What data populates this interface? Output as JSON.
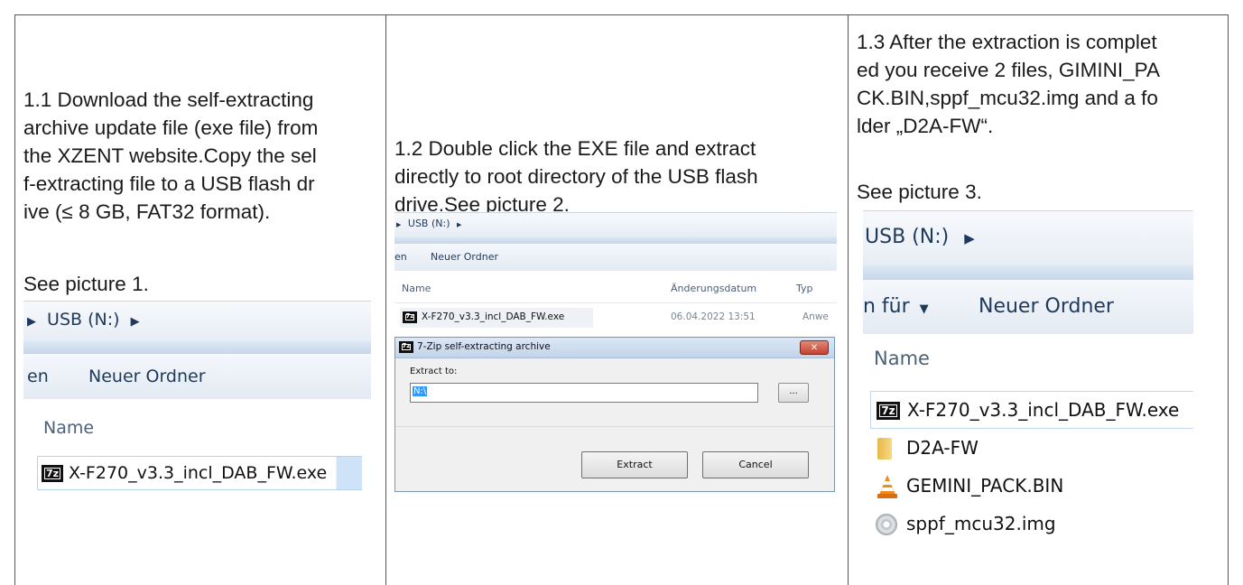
{
  "columns": [
    {
      "step_text": "1.1 Download the self-extracting\narchive update file (exe file) from\nthe XZENT website.Copy the sel\nf-extracting file to a USB flash dr\nive (≤ 8 GB, FAT32 format).",
      "picture_ref": "See picture 1.",
      "screenshot": {
        "breadcrumb": "USB (N:)",
        "toolbar_cut": "en",
        "new_folder": "Neuer Ordner",
        "column_name": "Name",
        "file_name": "X-F270_v3.3_incl_DAB_FW.exe"
      }
    },
    {
      "step_text": "1.2 Double click the EXE file and extract\ndirectly to root directory of the USB flash\ndrive.See picture 2.",
      "screenshot": {
        "breadcrumb": "USB (N:)",
        "toolbar_cut": "en",
        "new_folder": "Neuer Ordner",
        "column_name": "Name",
        "column_date": "Änderungsdatum",
        "column_type": "Typ",
        "file_name": "X-F270_v3.3_incl_DAB_FW.exe",
        "file_date": "06.04.2022 13:51",
        "file_type": "Anwe",
        "dialog": {
          "title": "7-Zip self-extracting archive",
          "close_glyph": "✕",
          "extract_to_label": "Extract to:",
          "path_value": "N:\\",
          "browse_label": "...",
          "extract_button": "Extract",
          "cancel_button": "Cancel"
        }
      }
    },
    {
      "step_text": "1.3 After the extraction is complet\ned you receive 2 files, GIMINI_PA\nCK.BIN,sppf_mcu32.img and a fo\nlder „D2A-FW“.",
      "picture_ref": "See picture 3.",
      "screenshot": {
        "breadcrumb": "USB (N:)",
        "toolbar_cut": "n für",
        "new_folder": "Neuer Ordner",
        "column_name": "Name",
        "files": [
          {
            "name": "X-F270_v3.3_incl_DAB_FW.exe",
            "icon": "7zip-icon"
          },
          {
            "name": "D2A-FW",
            "icon": "folder-icon"
          },
          {
            "name": "GEMINI_PACK.BIN",
            "icon": "vlc-cone-icon"
          },
          {
            "name": "sppf_mcu32.img",
            "icon": "disc-image-icon"
          }
        ]
      }
    }
  ],
  "colors": {
    "border": "#555555",
    "text": "#1a1a1a",
    "explorer_text": "#1e395b",
    "close_red": "#c8402f"
  }
}
